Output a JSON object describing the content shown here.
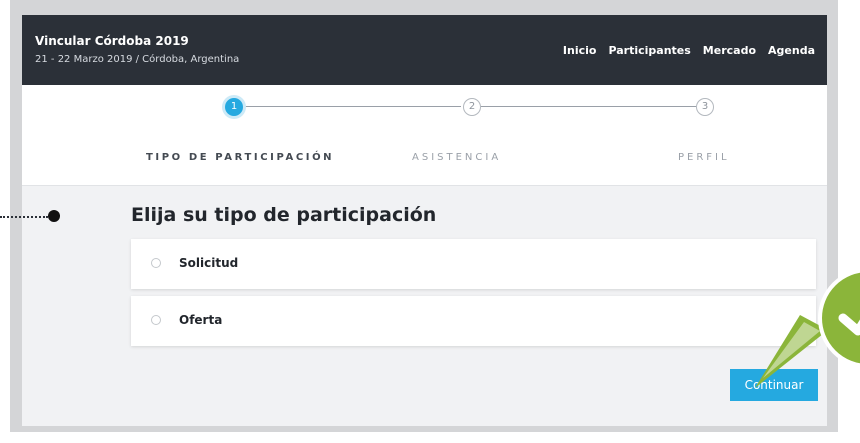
{
  "header": {
    "title": "Vincular Córdoba 2019",
    "subtitle": "21 - 22 Marzo 2019 / Córdoba, Argentina",
    "nav": [
      "Inicio",
      "Participantes",
      "Mercado",
      "Agenda"
    ]
  },
  "steps": [
    {
      "number": "1",
      "label": "TIPO DE PARTICIPACIÓN",
      "active": true
    },
    {
      "number": "2",
      "label": "ASISTENCIA",
      "active": false
    },
    {
      "number": "3",
      "label": "PERFIL",
      "active": false
    }
  ],
  "form": {
    "title": "Elija su tipo de participación",
    "options": [
      "Solicitud",
      "Oferta"
    ],
    "continue_label": "Continuar"
  },
  "colors": {
    "accent": "#25a9e0",
    "header_bg": "#2b3038",
    "callout_green": "#8bb53a"
  },
  "icons": {
    "callout": "checkmark-icon"
  }
}
